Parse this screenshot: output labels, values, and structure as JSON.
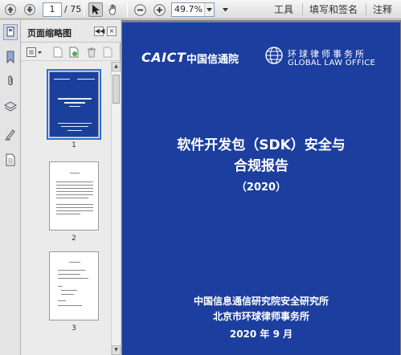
{
  "toolbar": {
    "page_current": "1",
    "page_total": "/ 75",
    "zoom_value": "49.7%",
    "menu": [
      "工具",
      "填写和签名",
      "注释"
    ]
  },
  "thumbnail_panel": {
    "title": "页面缩略图",
    "thumbnails": [
      {
        "label": "1",
        "selected": true
      },
      {
        "label": "2",
        "selected": false
      },
      {
        "label": "3",
        "selected": false
      }
    ]
  },
  "document": {
    "logo_caict": "CAICT",
    "logo_caict_cn": "中国信通院",
    "logo_glo_cn": "环球律师事务所",
    "logo_glo_en": "GLOBAL LAW OFFICE",
    "title_line1": "软件开发包（SDK）安全与",
    "title_line2": "合规报告",
    "title_year": "（2020）",
    "org_line1": "中国信息通信研究院安全研究所",
    "org_line2": "北京市环球律师事务所",
    "date": "2020 年 9 月"
  },
  "colors": {
    "cover_blue": "#1c3e9e",
    "selection_blue": "#2b6fd1"
  }
}
